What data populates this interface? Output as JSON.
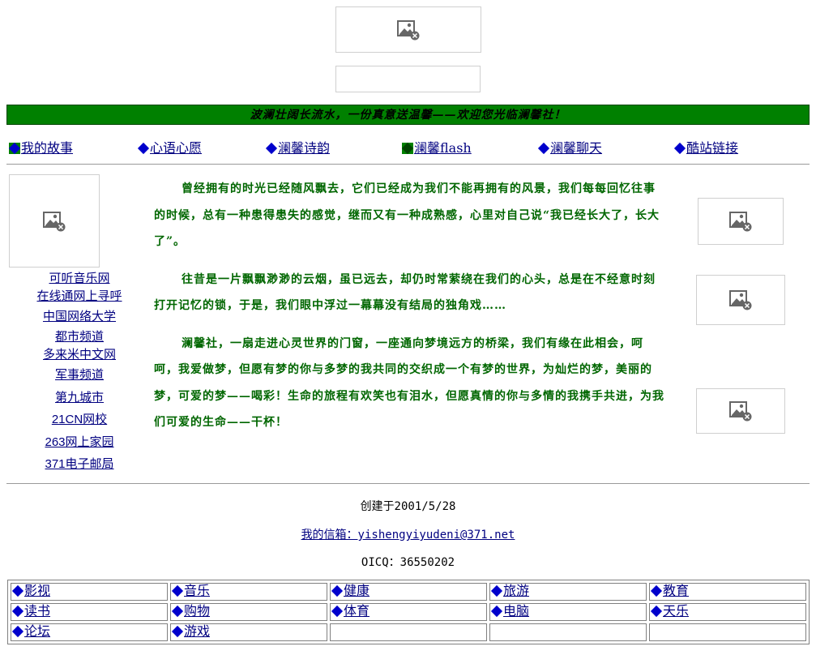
{
  "banner": "波澜壮阔长流水，一份真意送温馨——欢迎您光临澜馨社！",
  "nav": [
    {
      "label": "我的故事",
      "bullet": "green",
      "left": 0
    },
    {
      "label": "心语心愿",
      "bullet": "plain"
    },
    {
      "label": "澜馨诗韵",
      "bullet": "plain"
    },
    {
      "label": "澜馨flash",
      "bullet": "dark"
    },
    {
      "label": "澜馨聊天",
      "bullet": "plain"
    },
    {
      "label": "酷站链接",
      "bullet": "plain"
    }
  ],
  "left_links": [
    "可听音乐网",
    "在线通网上寻呼",
    "中国网络大学",
    "都市频道",
    "多来米中文网",
    "军事频道",
    "第九城市",
    "21CN网校",
    "263网上家园",
    "371电子邮局"
  ],
  "paragraphs": [
    "曾经拥有的时光已经随风飘去，它们已经成为我们不能再拥有的风景，我们每每回忆往事的时候，总有一种患得患失的感觉，继而又有一种成熟感，心里对自己说“我已经长大了，长大了”。",
    "往昔是一片飘飘渺渺的云烟，虽已远去，却仍时常萦绕在我们的心头，总是在不经意时刻打开记忆的锁，于是，我们眼中浮过一幕幕没有结局的独角戏……",
    "澜馨社，一扇走进心灵世界的门窗，一座通向梦境远方的桥梁，我们有缘在此相会，呵呵，我爱做梦，但愿有梦的你与多梦的我共同的交织成一个有梦的世界，为灿烂的梦，美丽的梦，可爱的梦——喝彩！生命的旅程有欢笑也有泪水，但愿真情的你与多情的我携手共进，为我们可爱的生命——干杯！"
  ],
  "footer": {
    "created": "创建于2001/5/28",
    "mailbox": "我的信箱：yishengyiyudeni@371.net",
    "oicq": "OICQ：36550202"
  },
  "bottom_links": [
    [
      "影视",
      "音乐",
      "健康",
      "旅游",
      "教育"
    ],
    [
      "读书",
      "购物",
      "体育",
      "电脑",
      "天乐"
    ],
    [
      "论坛",
      "游戏",
      "",
      "",
      ""
    ]
  ],
  "colors": {
    "banner_bg": "#008000",
    "text_green": "#006600",
    "link": "#000080",
    "bullet": "#0000cc"
  }
}
